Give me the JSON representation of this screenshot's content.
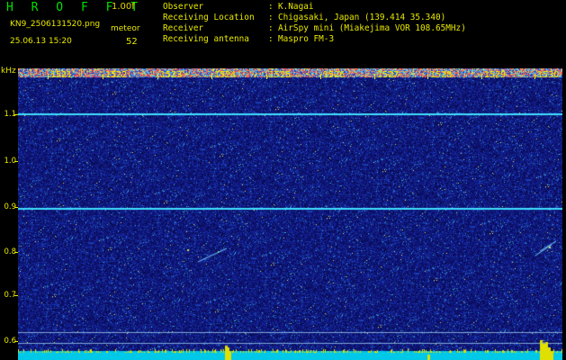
{
  "app": {
    "title": "H R O F F T",
    "version": "1.00f"
  },
  "file": {
    "name": "KN9_2506131520.png",
    "datetime": "25.06.13 15:20"
  },
  "meteor": {
    "label": "meteor",
    "count": "52"
  },
  "info": [
    {
      "key": "Observer",
      "value": "K.Nagai"
    },
    {
      "key": "Receiving Location",
      "value": "Chigasaki, Japan (139.414 35.340)"
    },
    {
      "key": "Receiver",
      "value": "AirSpy mini (Miakejima VOR 108.65MHz)"
    },
    {
      "key": "Receiving antenna",
      "value": "Maspro FM-3"
    }
  ],
  "axis": {
    "unit": "kHz",
    "freq_labels": [
      "1.1",
      "1.0",
      "0.9",
      "0.8",
      "0.7",
      "0.6"
    ],
    "time_labels": [
      "1521",
      "1522",
      "1523",
      "1524",
      "1525",
      "1526",
      "1527",
      "1528",
      "1529",
      "1530"
    ]
  },
  "colors": {
    "text": "#e8e800",
    "title": "#00e000",
    "background": "#10157a",
    "carrier": "#40e0ff",
    "noise_floor": "#00c8e8"
  }
}
